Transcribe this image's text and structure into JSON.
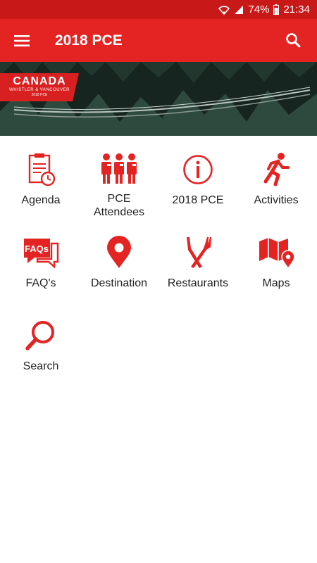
{
  "status_bar": {
    "battery": "74%",
    "time": "21:34"
  },
  "app_bar": {
    "title": "2018 PCE"
  },
  "banner": {
    "badge_title": "CANADA",
    "badge_subtitle": "WHISTLER & VANCOUVER",
    "badge_year": "2018 PCE"
  },
  "menu": [
    {
      "label": "Agenda",
      "icon": "agenda-icon"
    },
    {
      "label": "PCE\nAttendees",
      "icon": "attendees-icon"
    },
    {
      "label": "2018 PCE",
      "icon": "info-icon"
    },
    {
      "label": "Activities",
      "icon": "running-person-icon"
    },
    {
      "label": "FAQ's",
      "icon": "faqs-icon"
    },
    {
      "label": "Destination",
      "icon": "location-pin-icon"
    },
    {
      "label": "Restaurants",
      "icon": "fork-knife-icon"
    },
    {
      "label": "Maps",
      "icon": "map-icon"
    },
    {
      "label": "Search",
      "icon": "search-icon"
    }
  ],
  "colors": {
    "primary": "#e42323",
    "status_bar": "#c81818",
    "icon": "#e42323",
    "text": "#222222"
  }
}
